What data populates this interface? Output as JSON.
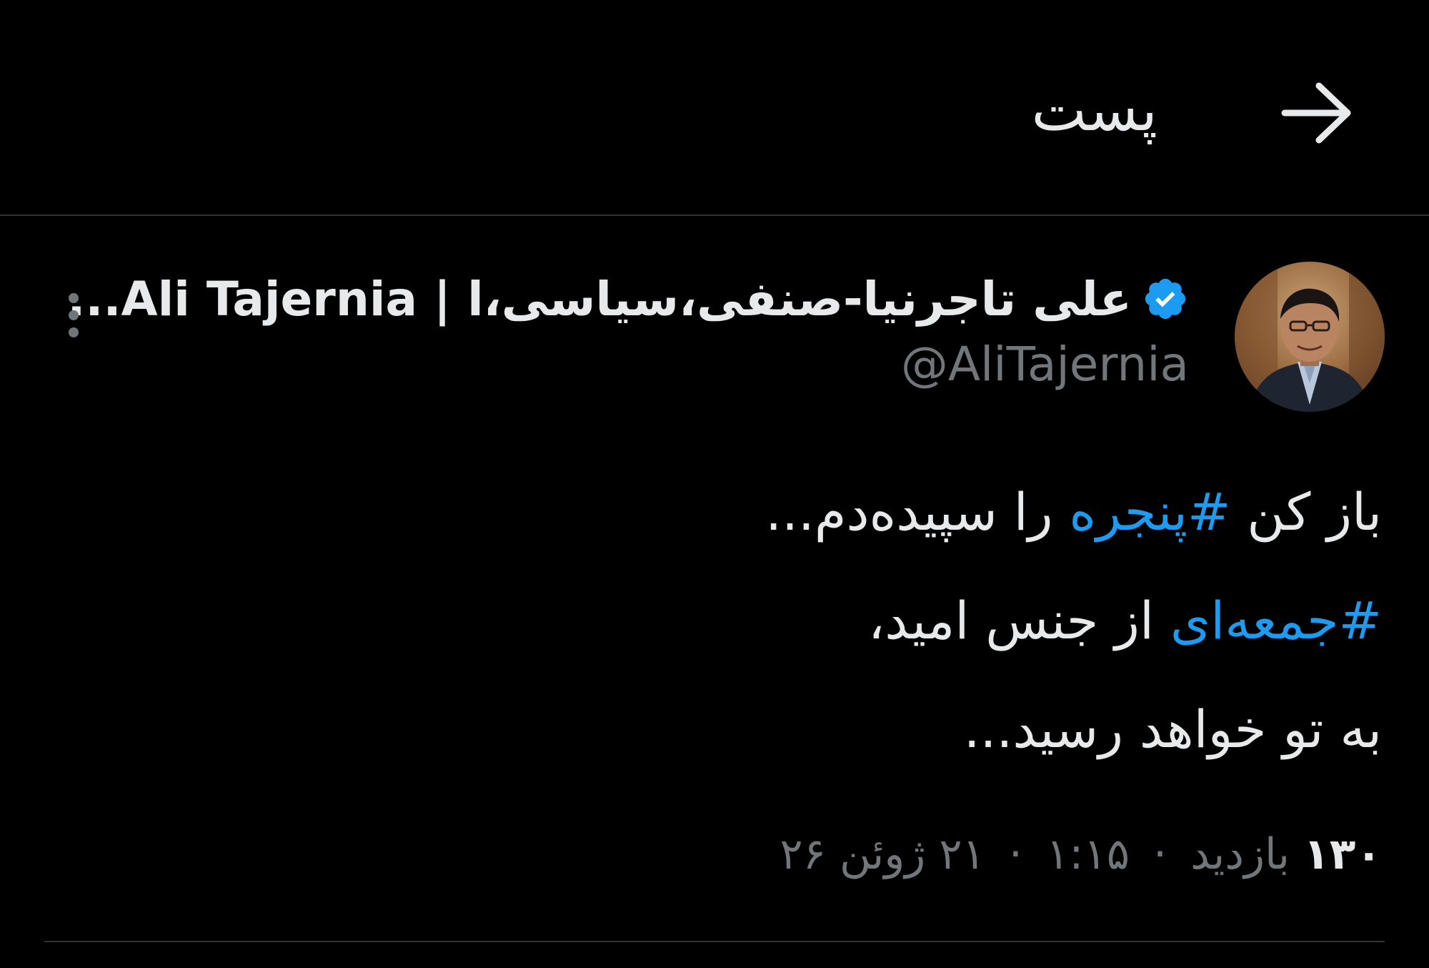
{
  "header": {
    "title": "پست",
    "back_icon": "arrow-right-icon"
  },
  "author": {
    "display_name": "...Ali Tajernia | علی تاجرنیا-صنفی،سیاسی،ا",
    "handle": "@AliTajernia",
    "verified_icon": "verified-badge-icon",
    "avatar_icon": "avatar-photo"
  },
  "more_icon": "more-vertical-icon",
  "tweet": {
    "line1_before": "باز کن ",
    "line1_hashtag": "#پنجره",
    "line1_after": " را سپیده‌دم...",
    "line2_hashtag": "#جمعه‌ای",
    "line2_after": " از جنس امید،",
    "line3": "به تو خواهد رسید..."
  },
  "meta": {
    "views_label": "بازدید",
    "views_count": "۱۳۰",
    "time": "۱:۱۵",
    "date": "۲۱ ژوئن ۲۶",
    "separator": "·"
  },
  "colors": {
    "background": "#000000",
    "text": "#e7e9ea",
    "secondary": "#71767b",
    "accent": "#1d9bf0",
    "divider": "#2f3336"
  }
}
